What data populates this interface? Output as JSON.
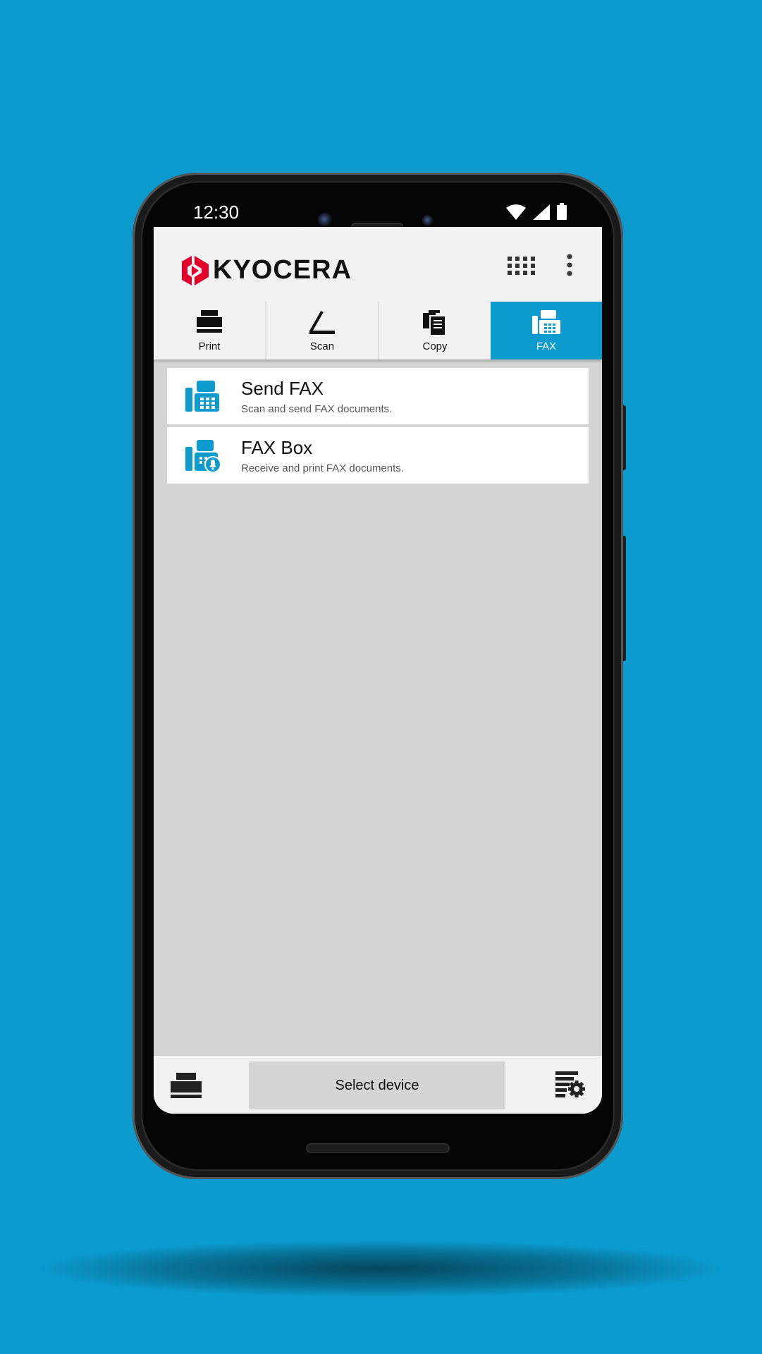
{
  "status_bar": {
    "time": "12:30"
  },
  "app_bar": {
    "logo_text": "KYOCERA",
    "apps_icon": "grid-icon",
    "more_icon": "more-vert-icon"
  },
  "tabs": [
    {
      "label": "Print",
      "icon": "printer-icon",
      "active": false
    },
    {
      "label": "Scan",
      "icon": "scanner-icon",
      "active": false
    },
    {
      "label": "Copy",
      "icon": "copy-icon",
      "active": false
    },
    {
      "label": "FAX",
      "icon": "fax-icon",
      "active": true
    }
  ],
  "items": [
    {
      "title": "Send FAX",
      "description": "Scan and send FAX documents.",
      "icon": "fax-icon"
    },
    {
      "title": "FAX Box",
      "description": "Receive and print FAX documents.",
      "icon": "fax-box-icon"
    }
  ],
  "bottom_bar": {
    "select_device_label": "Select device",
    "left_icon": "printer-icon",
    "right_icon": "device-settings-icon"
  },
  "colors": {
    "accent": "#0b9bce",
    "logo_red": "#e3002b",
    "background": "#d4d4d4"
  }
}
